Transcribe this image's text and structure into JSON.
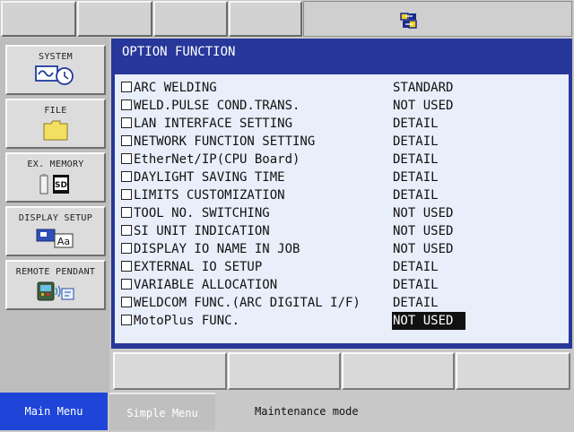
{
  "sidebar": {
    "items": [
      {
        "label": "SYSTEM"
      },
      {
        "label": "FILE"
      },
      {
        "label": "EX. MEMORY"
      },
      {
        "label": "DISPLAY SETUP"
      },
      {
        "label": "REMOTE PENDANT"
      }
    ]
  },
  "main": {
    "title": "OPTION FUNCTION",
    "rows": [
      {
        "name": "ARC WELDING",
        "value": "STANDARD"
      },
      {
        "name": "WELD.PULSE COND.TRANS.",
        "value": "NOT USED"
      },
      {
        "name": "LAN INTERFACE SETTING",
        "value": "DETAIL"
      },
      {
        "name": "NETWORK FUNCTION SETTING",
        "value": "DETAIL"
      },
      {
        "name": "EtherNet/IP(CPU Board)",
        "value": "DETAIL"
      },
      {
        "name": "DAYLIGHT SAVING TIME",
        "value": "DETAIL"
      },
      {
        "name": "LIMITS CUSTOMIZATION",
        "value": "DETAIL"
      },
      {
        "name": "TOOL NO. SWITCHING",
        "value": "NOT USED"
      },
      {
        "name": "SI UNIT INDICATION",
        "value": "NOT USED"
      },
      {
        "name": "DISPLAY IO NAME IN JOB",
        "value": "NOT USED"
      },
      {
        "name": "EXTERNAL IO SETUP",
        "value": "DETAIL"
      },
      {
        "name": "VARIABLE ALLOCATION",
        "value": "DETAIL"
      },
      {
        "name": "WELDCOM FUNC.(ARC DIGITAL I/F)",
        "value": "DETAIL"
      },
      {
        "name": "MotoPlus FUNC.",
        "value": "NOT USED",
        "selected": true
      }
    ]
  },
  "bottom": {
    "main_menu": "Main Menu",
    "simple_menu": "Simple Menu",
    "status": "Maintenance mode"
  },
  "colors": {
    "panel_blue": "#27379a",
    "main_menu_blue": "#1f45d8",
    "content_bg": "#e8eefa"
  },
  "icons": [
    "system-icon",
    "folder-icon",
    "sd-card-icon",
    "display-setup-icon",
    "remote-pendant-icon",
    "status-indicator-icon"
  ]
}
